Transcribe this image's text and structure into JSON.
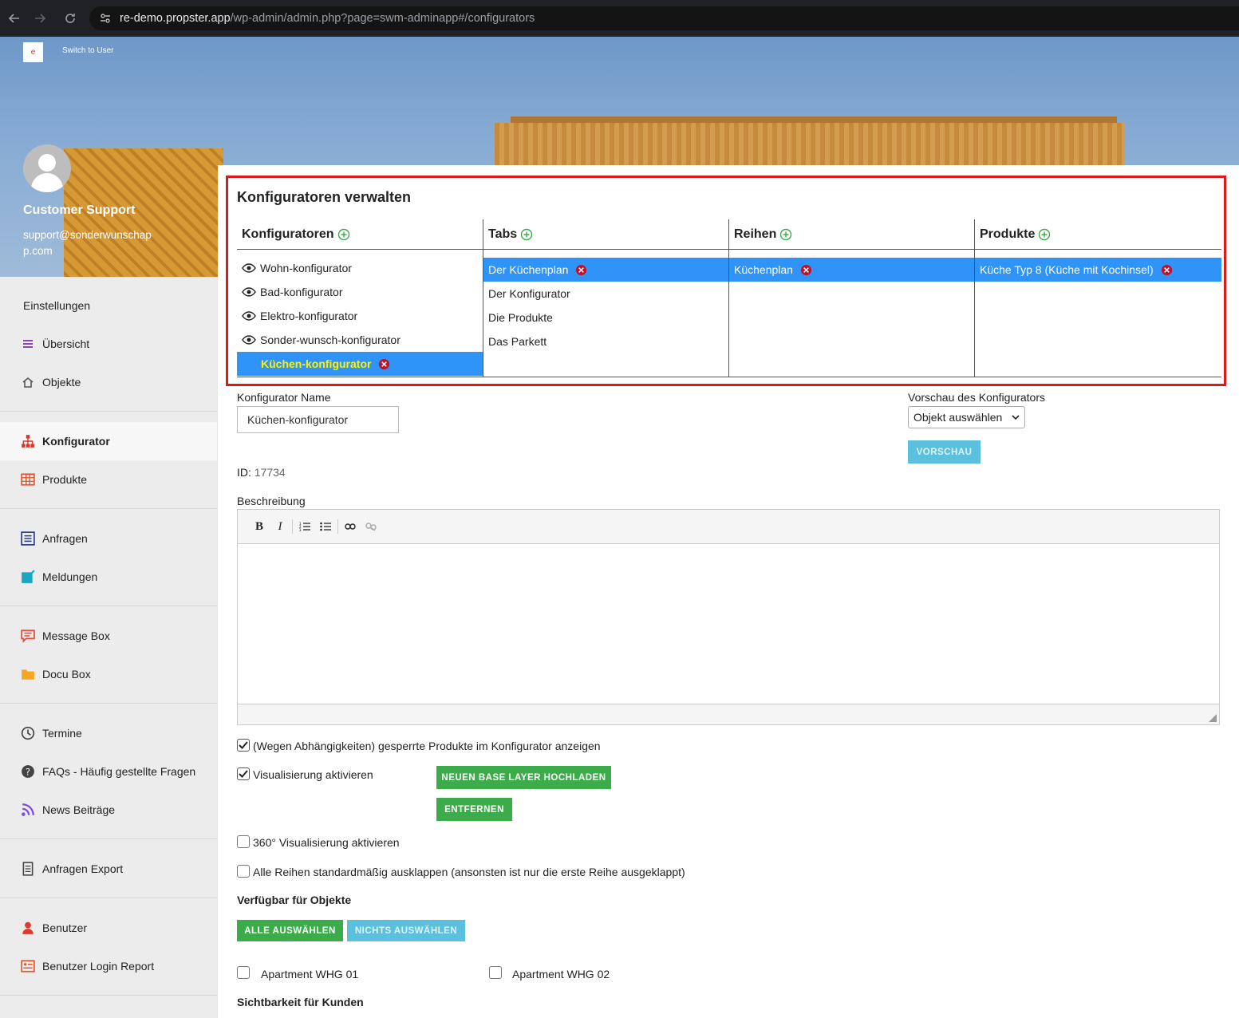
{
  "browser": {
    "url_host": "re-demo.propster.app",
    "url_path": "/wp-admin/admin.php?page=swm-adminapp#/configurators"
  },
  "header": {
    "switch_user": "Switch to User"
  },
  "profile": {
    "name": "Customer Support",
    "email": "support@sonderwunschapp.com"
  },
  "sidebar": {
    "items": [
      {
        "label": "Einstellungen",
        "icon": "none"
      },
      {
        "label": "Übersicht",
        "icon": "hamburger-icon"
      },
      {
        "label": "Objekte",
        "icon": "home-icon"
      },
      {
        "label": "Konfigurator",
        "icon": "sitemap-icon"
      },
      {
        "label": "Produkte",
        "icon": "grid-icon"
      },
      {
        "label": "Anfragen",
        "icon": "list-icon"
      },
      {
        "label": "Meldungen",
        "icon": "edit-icon"
      },
      {
        "label": "Message Box",
        "icon": "message-icon"
      },
      {
        "label": "Docu Box",
        "icon": "folder-icon"
      },
      {
        "label": "Termine",
        "icon": "clock-icon"
      },
      {
        "label": "FAQs - Häufig gestellte Fragen",
        "icon": "question-icon"
      },
      {
        "label": "News Beiträge",
        "icon": "rss-icon"
      },
      {
        "label": "Anfragen Export",
        "icon": "document-icon"
      },
      {
        "label": "Benutzer",
        "icon": "user-icon"
      },
      {
        "label": "Benutzer Login Report",
        "icon": "report-icon"
      }
    ]
  },
  "panel": {
    "title": "Konfiguratoren verwalten",
    "columns": {
      "konfiguratoren": "Konfiguratoren",
      "tabs": "Tabs",
      "reihen": "Reihen",
      "produkte": "Produkte"
    },
    "konfiguratoren_items": [
      "Wohn-konfigurator",
      "Bad-konfigurator",
      "Elektro-konfigurator",
      "Sonder-wunsch-konfigurator",
      "Küchen-konfigurator"
    ],
    "tabs_items": [
      "Der Küchenplan",
      "Der Konfigurator",
      "Die Produkte",
      "Das Parkett"
    ],
    "reihen_items": [
      "Küchenplan"
    ],
    "produkte_items": [
      "Küche Typ 8 (Küche mit Kochinsel)"
    ]
  },
  "form": {
    "name_label": "Konfigurator Name",
    "name_value": "Küchen-konfigurator",
    "preview_label": "Vorschau des Konfigurators",
    "preview_select": "Objekt auswählen",
    "preview_button": "VORSCHAU",
    "id_label": "ID:",
    "id_value": "17734",
    "description_label": "Beschreibung",
    "check_locked": "(Wegen Abhängigkeiten) gesperrte Produkte im Konfigurator anzeigen",
    "check_visual": "Visualisierung aktivieren",
    "upload_button": "NEUEN BASE LAYER HOCHLADEN",
    "remove_button": "ENTFERNEN",
    "check_360": "360° Visualisierung aktivieren",
    "check_expand": "Alle Reihen standardmäßig ausklappen (ansonsten ist nur die erste Reihe ausgeklappt)",
    "available_title": "Verfügbar für Objekte",
    "select_all": "ALLE AUSWÄHLEN",
    "select_none": "NICHTS AUSWÄHLEN",
    "apartment1": "Apartment WHG 01",
    "apartment2": "Apartment WHG 02",
    "visibility_title": "Sichtbarkeit für Kunden"
  }
}
